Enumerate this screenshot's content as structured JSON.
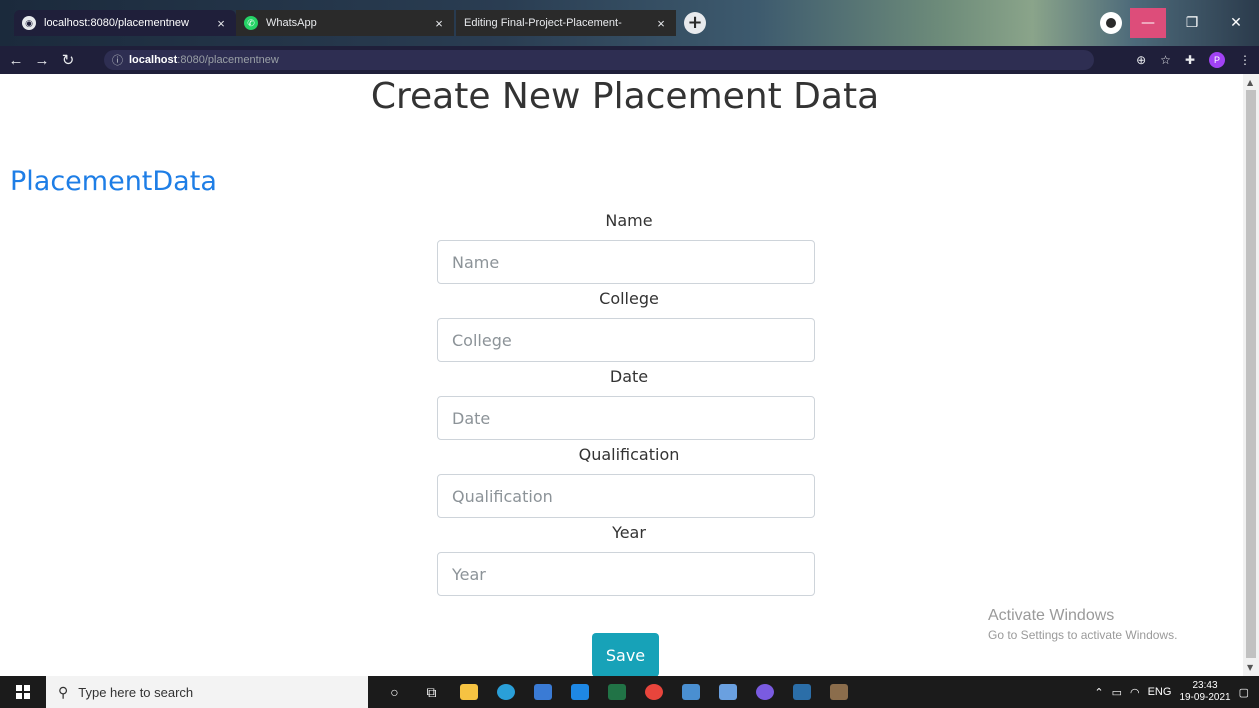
{
  "browser": {
    "tabs": [
      {
        "label": "localhost:8080/placementnew",
        "icon": "globe-icon",
        "active": true
      },
      {
        "label": "WhatsApp",
        "icon": "whatsapp-icon",
        "active": false
      },
      {
        "label": "Editing Final-Project-Placement-",
        "icon": "",
        "active": false
      }
    ],
    "close_glyph": "×",
    "new_tab_glyph": "+",
    "url_host": "localhost",
    "url_rest": ":8080/placementnew",
    "profile_initial": "P",
    "window_controls": {
      "minimize": "—",
      "maximize": "❐",
      "close": "✕"
    }
  },
  "page": {
    "title": "Create New Placement Data",
    "section_heading": "PlacementData",
    "fields": [
      {
        "label": "Name",
        "placeholder": "Name",
        "value": ""
      },
      {
        "label": "College",
        "placeholder": "College",
        "value": ""
      },
      {
        "label": "Date",
        "placeholder": "Date",
        "value": ""
      },
      {
        "label": "Qualification",
        "placeholder": "Qualification",
        "value": ""
      },
      {
        "label": "Year",
        "placeholder": "Year",
        "value": ""
      }
    ],
    "save_label": "Save"
  },
  "watermark": {
    "line1": "Activate Windows",
    "line2": "Go to Settings to activate Windows."
  },
  "taskbar": {
    "search_placeholder": "Type here to search",
    "language": "ENG",
    "time": "23:43",
    "date": "19-09-2021"
  },
  "colors": {
    "heading_blue": "#1e7ee6",
    "save_button": "#17a2b8",
    "chrome_toolbar": "#1f1f3a"
  }
}
